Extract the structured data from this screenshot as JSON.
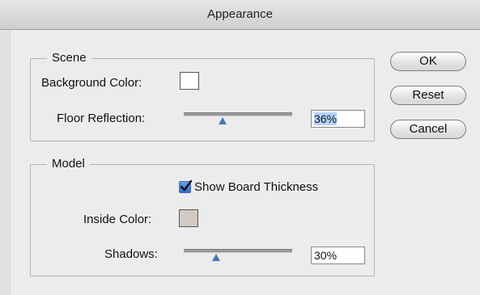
{
  "window": {
    "title": "Appearance"
  },
  "scene": {
    "group_label": "Scene",
    "background_color_label": "Background Color:",
    "background_color": "#ffffff",
    "floor_reflection_label": "Floor Reflection:",
    "floor_reflection_value": "36%",
    "floor_reflection_level": 0.36
  },
  "model": {
    "group_label": "Model",
    "show_board_thickness_label": "Show Board Thickness",
    "show_board_thickness_checked": true,
    "inside_color_label": "Inside Color:",
    "inside_color": "#d3cbc3",
    "shadows_label": "Shadows:",
    "shadows_value": "30%",
    "shadows_level": 0.3
  },
  "buttons": {
    "ok": "OK",
    "reset": "Reset",
    "cancel": "Cancel"
  },
  "colors": {
    "accent": "#4a78b8",
    "selection": "#b5d4ff"
  }
}
